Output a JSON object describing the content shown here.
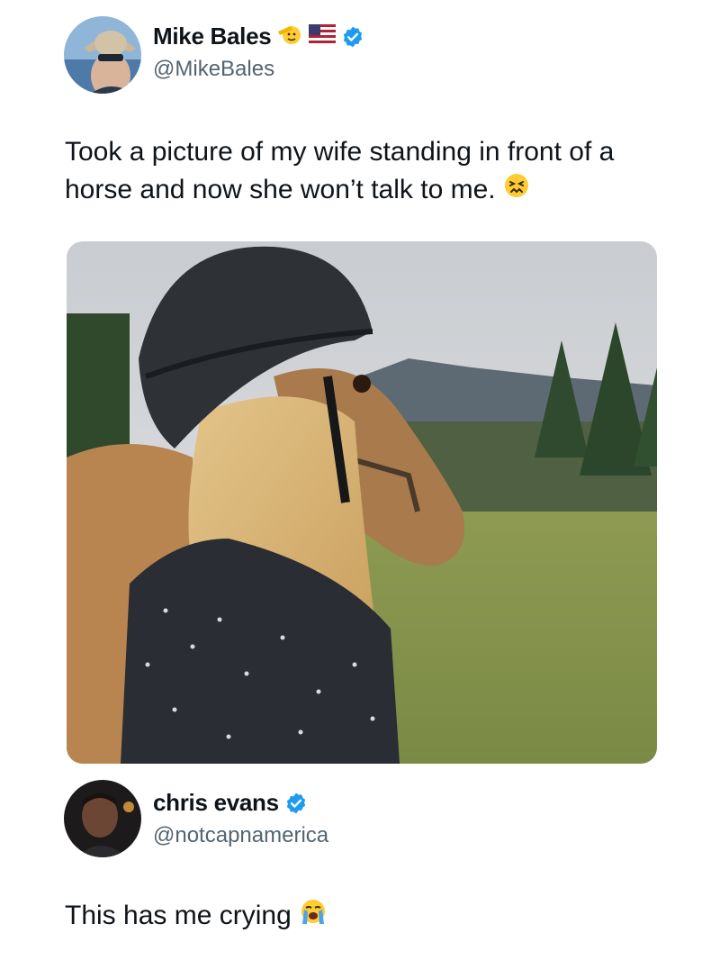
{
  "post": {
    "display_name": "Mike Bales",
    "handle": "@MikeBales",
    "text": "Took a picture of my wife standing in front of a horse and now she won’t talk to me.",
    "name_emojis": [
      "salute-face-emoji",
      "us-flag-emoji"
    ],
    "verified": true,
    "text_emoji": "confounded-face-emoji",
    "media": {
      "subject": "horse-photo"
    }
  },
  "reply": {
    "display_name": "chris evans",
    "handle": "@notcapnamerica",
    "text": "This has me crying",
    "verified": true,
    "text_emoji": "loudly-crying-face-emoji"
  },
  "colors": {
    "verified_blue": "#1d9bf0",
    "handle_gray": "#536471",
    "text": "#0f1419"
  }
}
